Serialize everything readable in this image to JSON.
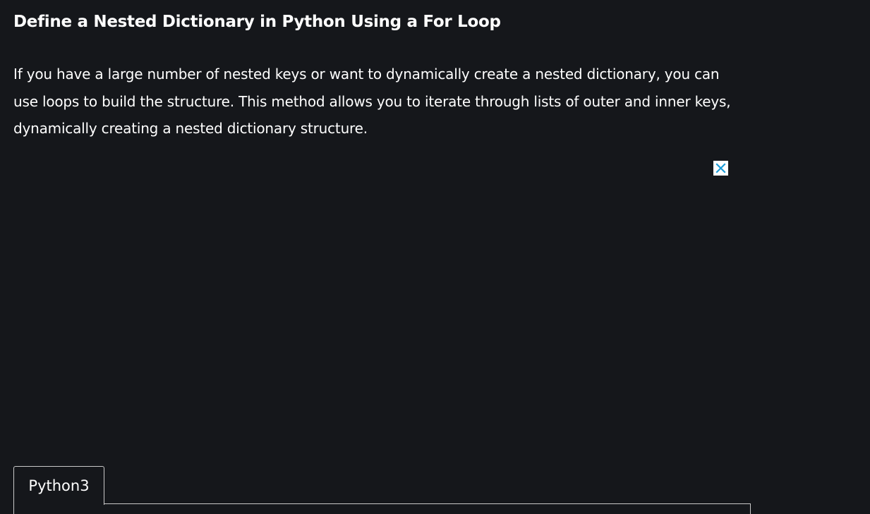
{
  "article": {
    "heading": "Define a Nested Dictionary in Python Using a For Loop",
    "paragraph": "If you have a large number of nested keys or want to dynamically create a nested dictionary, you can use loops to build the structure. This method allows you to iterate through lists of outer and inner keys, dynamically creating a nested dictionary structure."
  },
  "ad": {
    "close_icon": "close-icon",
    "close_icon_color": "#1a9bd7"
  },
  "code_block": {
    "tabs": [
      {
        "label": "Python3",
        "active": true
      }
    ]
  },
  "colors": {
    "background": "#15171b",
    "text": "#ffffff",
    "border": "#c9c9c9"
  }
}
